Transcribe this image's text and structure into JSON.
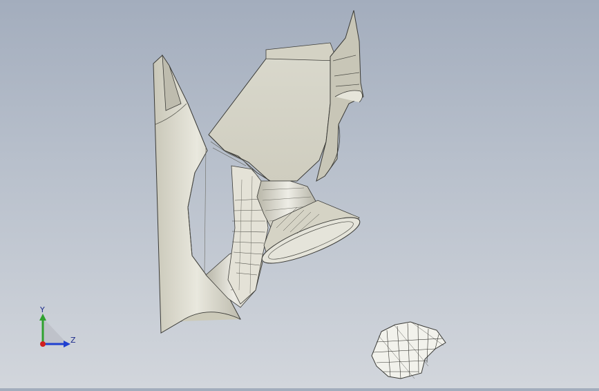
{
  "viewport": {
    "background_top": "#a3adbd",
    "background_bottom": "#d2d6dc",
    "model_color": "#d8d6c8",
    "edge_color": "#3a3a36",
    "mesh_color": "#f2f2ec"
  },
  "triad": {
    "y_label": "Y",
    "z_label": "Z",
    "y_color": "#2fa12f",
    "z_color": "#2040d0",
    "x_color": "#d02020"
  }
}
